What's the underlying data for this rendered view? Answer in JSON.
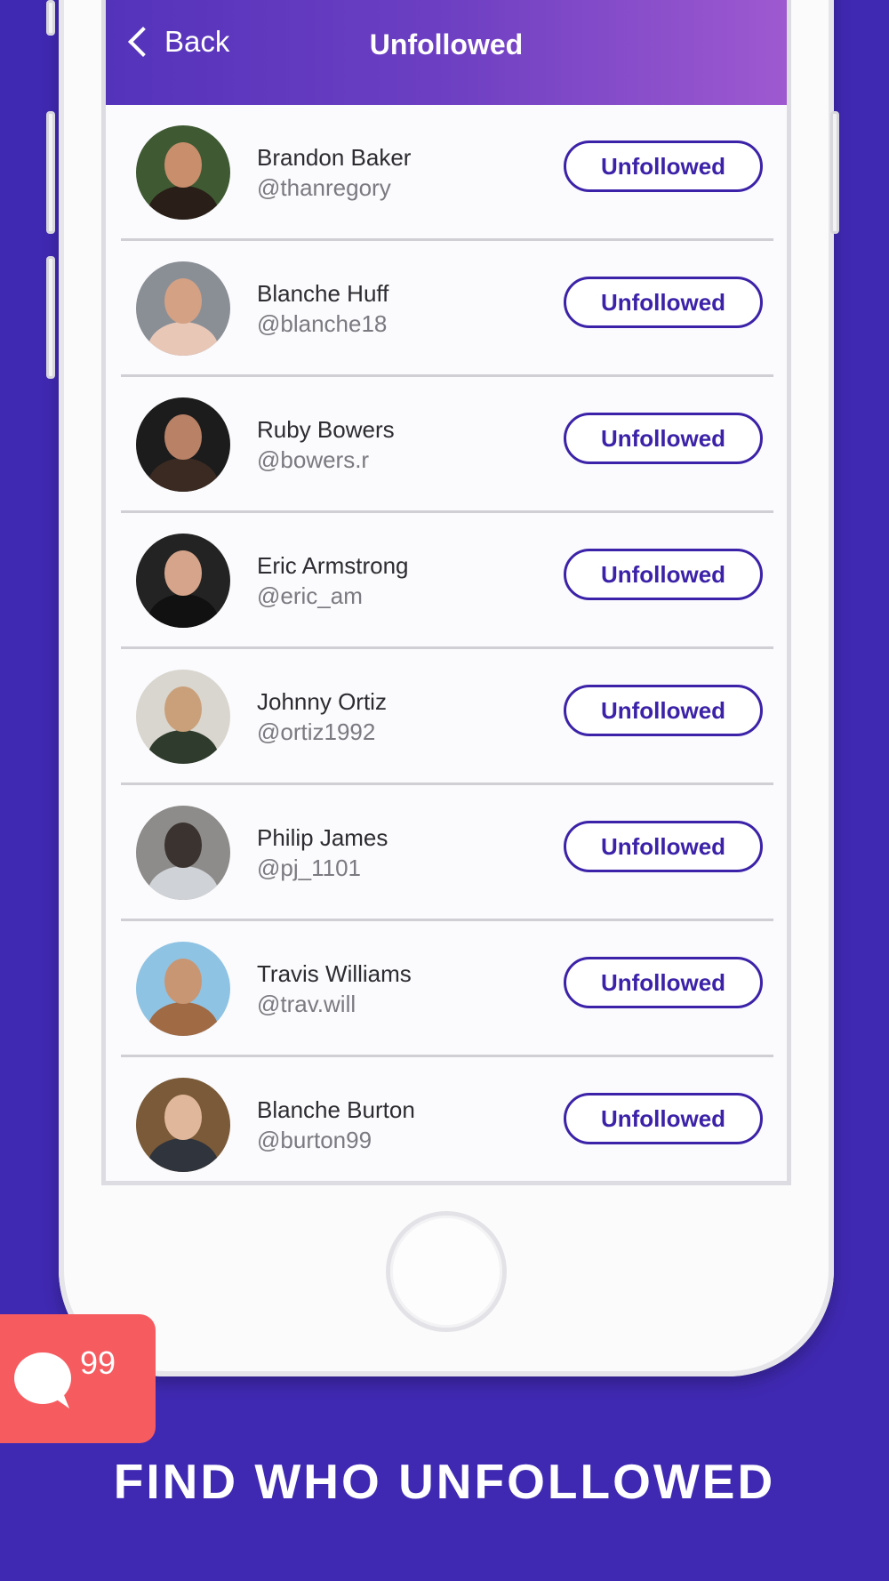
{
  "header": {
    "back_label": "Back",
    "title": "Unfollowed"
  },
  "users": [
    {
      "name": "Brandon Baker",
      "handle": "@thanregory",
      "button": "Unfollowed",
      "photo": {
        "bg": "#3f5a33",
        "skin": "#c98e6c",
        "shirt": "#2a1e18"
      }
    },
    {
      "name": "Blanche Huff",
      "handle": "@blanche18",
      "button": "Unfollowed",
      "photo": {
        "bg": "#8a8f96",
        "skin": "#d4a184",
        "shirt": "#e8c7b7"
      }
    },
    {
      "name": "Ruby Bowers",
      "handle": "@bowers.r",
      "button": "Unfollowed",
      "photo": {
        "bg": "#1c1c1c",
        "skin": "#b98166",
        "shirt": "#3a2a22"
      }
    },
    {
      "name": "Eric Armstrong",
      "handle": "@eric_am",
      "button": "Unfollowed",
      "photo": {
        "bg": "#232323",
        "skin": "#d6a48a",
        "shirt": "#111111"
      }
    },
    {
      "name": "Johnny Ortiz",
      "handle": "@ortiz1992",
      "button": "Unfollowed",
      "photo": {
        "bg": "#d9d6cf",
        "skin": "#caa07a",
        "shirt": "#2f3b2c"
      }
    },
    {
      "name": "Philip James",
      "handle": "@pj_1101",
      "button": "Unfollowed",
      "photo": {
        "bg": "#8d8c8a",
        "skin": "#3a332f",
        "shirt": "#cfd2d6"
      }
    },
    {
      "name": "Travis Williams",
      "handle": "@trav.will",
      "button": "Unfollowed",
      "photo": {
        "bg": "#8fc3e3",
        "skin": "#c99673",
        "shirt": "#a06a45"
      }
    },
    {
      "name": "Blanche Burton",
      "handle": "@burton99",
      "button": "Unfollowed",
      "photo": {
        "bg": "#7a5a38",
        "skin": "#e0b79a",
        "shirt": "#30343c"
      }
    }
  ],
  "badge": {
    "icon": "chat-bubble-icon",
    "count": "99",
    "color": "#f65b60"
  },
  "tagline": "FIND WHO UNFOLLOWED",
  "colors": {
    "background": "#4029b2",
    "accent": "#3b22a8",
    "header_gradient_start": "#5433bb",
    "header_gradient_end": "#9e59d0"
  }
}
